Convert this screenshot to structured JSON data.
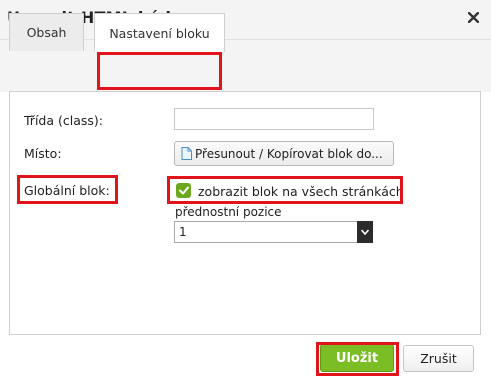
{
  "dialog": {
    "title": "Upravit HTML kód",
    "close_icon": "close-icon"
  },
  "tabs": [
    {
      "label": "Obsah",
      "active": false
    },
    {
      "label": "Nastavení bloku",
      "active": true
    }
  ],
  "form": {
    "class_label": "Třída (class):",
    "class_value": "",
    "place_label": "Místo:",
    "place_button": "Přesunout / Kopírovat blok do...",
    "global_label": "Globální blok:",
    "global_checkbox_label": "zobrazit blok na všech stránkách",
    "global_checked": true,
    "priority_label": "přednostní pozice",
    "priority_value": "1"
  },
  "footer": {
    "save_label": "Uložit",
    "cancel_label": "Zrušit"
  },
  "colors": {
    "accent_green": "#7bbd25",
    "highlight_red": "#e0141b"
  }
}
